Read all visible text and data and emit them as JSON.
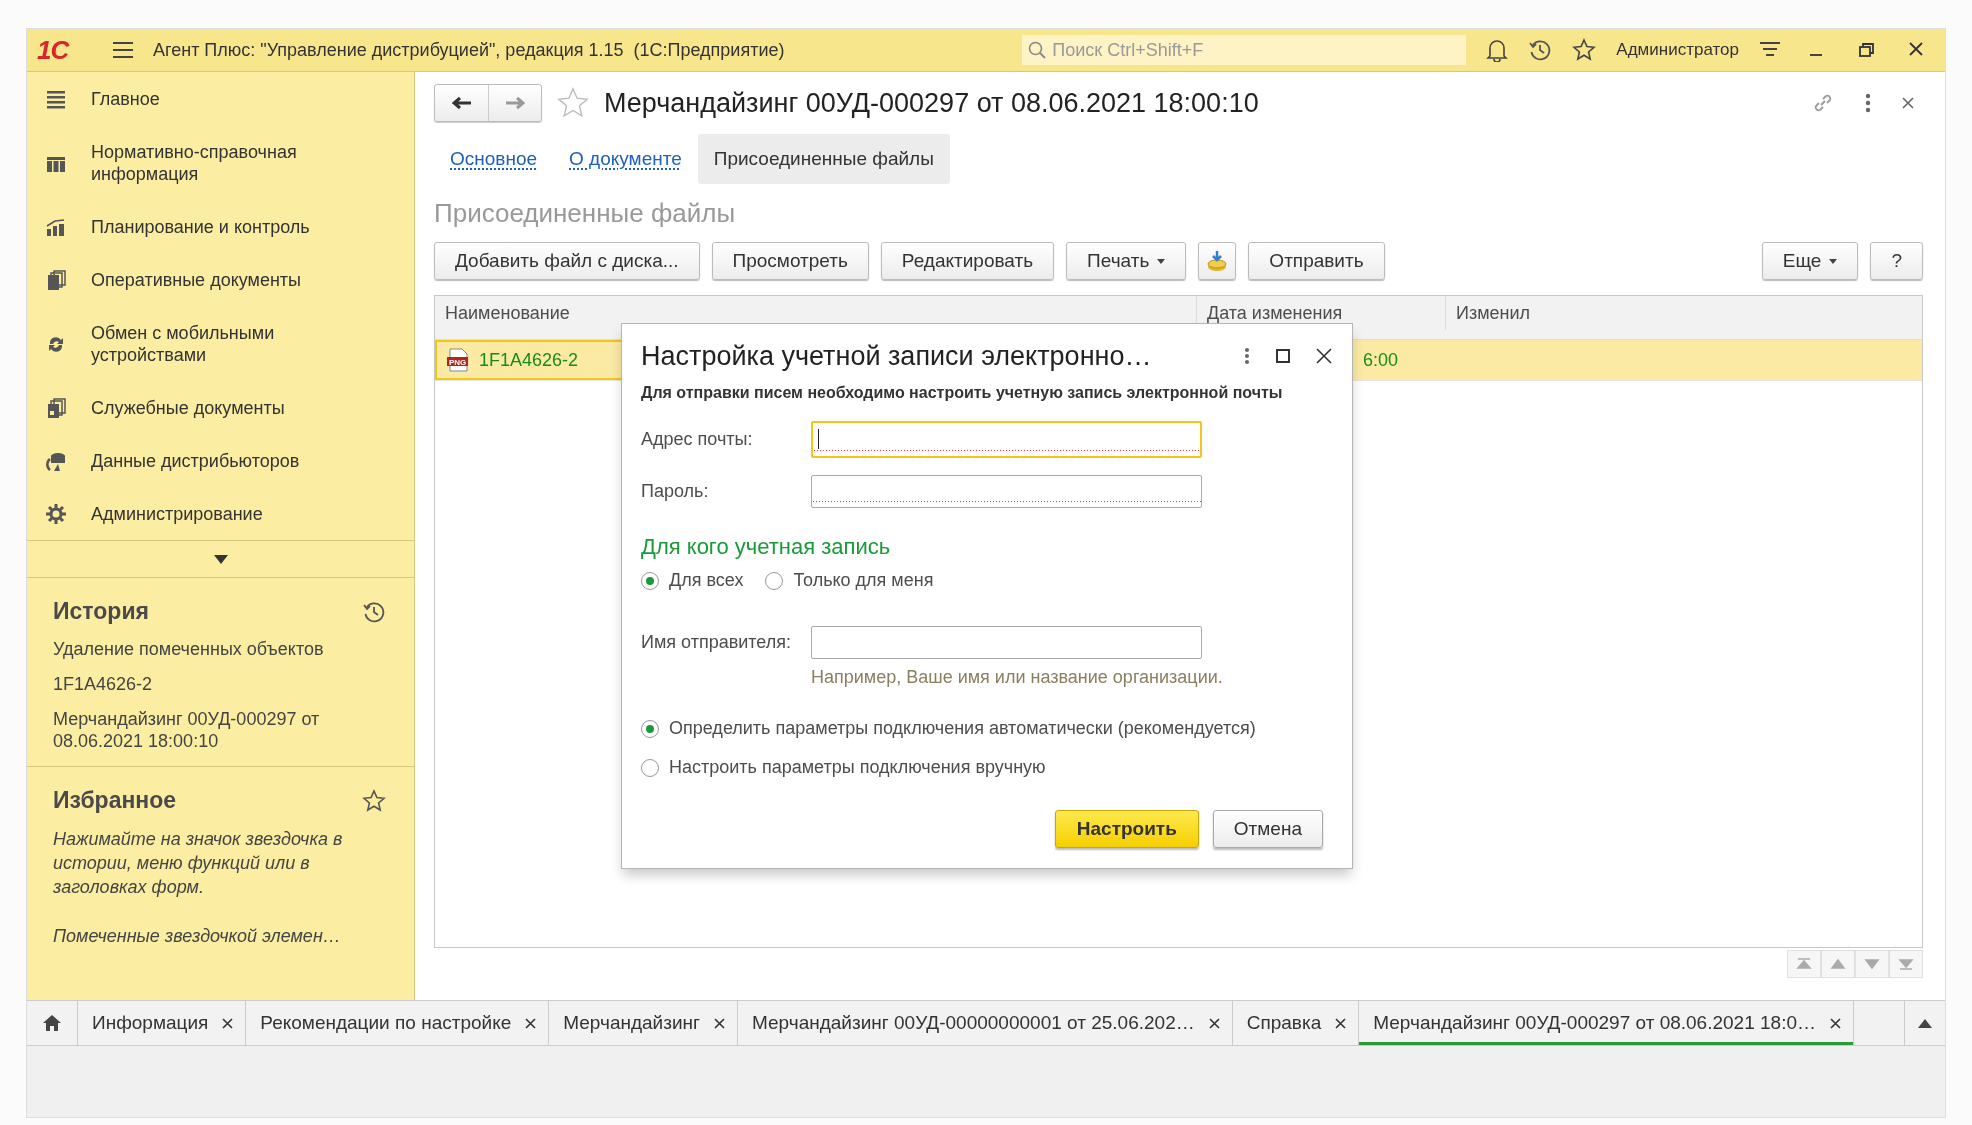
{
  "app_bar": {
    "logo": "1С",
    "title": "Агент Плюс: \"Управление дистрибуцией\", редакция 1.15  (1С:Предприятие)",
    "search": {
      "placeholder": "Поиск Ctrl+Shift+F"
    },
    "user": "Администратор"
  },
  "sidebar": {
    "items": [
      {
        "label": "Главное"
      },
      {
        "label": "Нормативно-справочная информация"
      },
      {
        "label": "Планирование и контроль"
      },
      {
        "label": "Оперативные документы"
      },
      {
        "label": "Обмен с мобильными устройствами"
      },
      {
        "label": "Служебные документы"
      },
      {
        "label": "Данные дистрибьюторов"
      },
      {
        "label": "Администрирование"
      }
    ],
    "history": {
      "title": "История",
      "items": [
        "Удаление помеченных объектов",
        "1F1A4626-2",
        "Мерчандайзинг 00УД-000297 от 08.06.2021 18:00:10"
      ]
    },
    "favorites": {
      "title": "Избранное",
      "hint": "Нажимайте на значок звездочка в истории, меню функций или в заголовках форм.",
      "hint_more": "Помеченные звездочкой элемен…"
    }
  },
  "form": {
    "title": "Мерчандайзинг 00УД-000297 от 08.06.2021 18:00:10",
    "tabs": [
      {
        "label": "Основное",
        "selected": false
      },
      {
        "label": "О документе",
        "selected": false
      },
      {
        "label": "Присоединенные файлы",
        "selected": true
      }
    ],
    "section_title": "Присоединенные файлы",
    "toolbar": [
      {
        "kind": "button",
        "label": "Добавить файл с диска..."
      },
      {
        "kind": "button",
        "label": "Просмотреть"
      },
      {
        "kind": "button",
        "label": "Редактировать"
      },
      {
        "kind": "menu",
        "label": "Печать"
      },
      {
        "kind": "icon"
      },
      {
        "kind": "button",
        "label": "Отправить"
      }
    ],
    "toolbar_right": [
      {
        "kind": "menu",
        "label": "Еще"
      },
      {
        "kind": "button",
        "label": "?"
      }
    ],
    "table": {
      "columns": [
        "Наименование",
        "Дата изменения",
        "Изменил"
      ],
      "rows": [
        {
          "name": "1F1A4626-2",
          "file_type": "PNG",
          "column_2": "6:00",
          "selected": true
        }
      ]
    }
  },
  "dialog": {
    "title": "Настройка учетной записи электронно…",
    "note": "Для отправки писем необходимо настроить учетную запись электронной почты",
    "fields": [
      {
        "label": "Адрес почты:",
        "focused": true,
        "required": true
      },
      {
        "label": "Пароль:",
        "focused": false,
        "required": true
      }
    ],
    "section_title": "Для кого учетная запись",
    "audience": [
      {
        "label": "Для всех",
        "selected": true
      },
      {
        "label": "Только для меня",
        "selected": false
      }
    ],
    "sender": {
      "label": "Имя отправителя:",
      "focused": false,
      "required": false,
      "hint": "Например, Ваше имя или название организации."
    },
    "connection": [
      {
        "label": "Определить параметры подключения автоматически (рекомендуется)",
        "selected": true
      },
      {
        "label": "Настроить параметры подключения вручную",
        "selected": false
      }
    ],
    "buttons": [
      {
        "label": "Настроить",
        "kind": "primary"
      },
      {
        "label": "Отмена",
        "kind": "default"
      }
    ]
  },
  "open_tabs": [
    {
      "label": "Информация",
      "selected": false
    },
    {
      "label": "Рекомендации по настройке",
      "selected": false
    },
    {
      "label": "Мерчандайзинг",
      "selected": false
    },
    {
      "label": "Мерчандайзинг 00УД-00000000001 от 25.06.202…",
      "selected": false
    },
    {
      "label": "Справка",
      "selected": false
    },
    {
      "label": "Мерчандайзинг 00УД-000297 от 08.06.2021 18:0…",
      "selected": true
    }
  ]
}
